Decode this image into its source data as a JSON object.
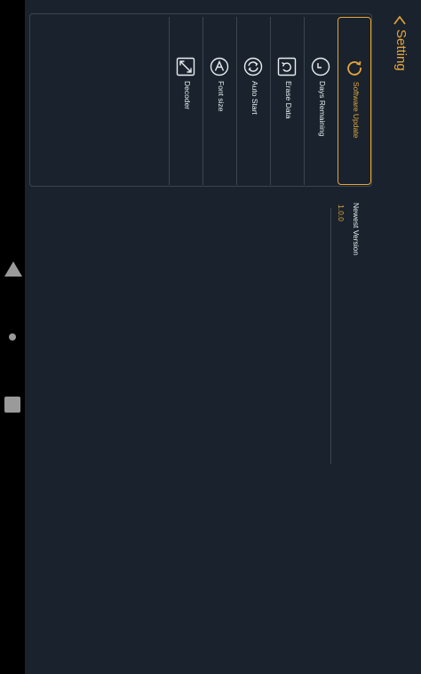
{
  "header": {
    "title": "Setting"
  },
  "tabs": [
    {
      "id": "software-update",
      "label": "Software Update",
      "icon": "refresh-icon",
      "active": true
    },
    {
      "id": "days-remaining",
      "label": "Days Remaining",
      "icon": "clock-icon",
      "active": false
    },
    {
      "id": "erase-data",
      "label": "Erase Data",
      "icon": "erase-icon",
      "active": false
    },
    {
      "id": "auto-start",
      "label": "Auto Start",
      "icon": "sync-icon",
      "active": false
    },
    {
      "id": "font-size",
      "label": "Font size",
      "icon": "font-icon",
      "active": false
    },
    {
      "id": "decoder",
      "label": "Decoder",
      "icon": "resize-icon",
      "active": false
    }
  ],
  "detail": {
    "label": "Newest Version",
    "value": "1.0.0"
  },
  "colors": {
    "accent": "#e6a53a",
    "background": "#1a232d",
    "border": "#3b4650",
    "text": "#e9edf1"
  }
}
